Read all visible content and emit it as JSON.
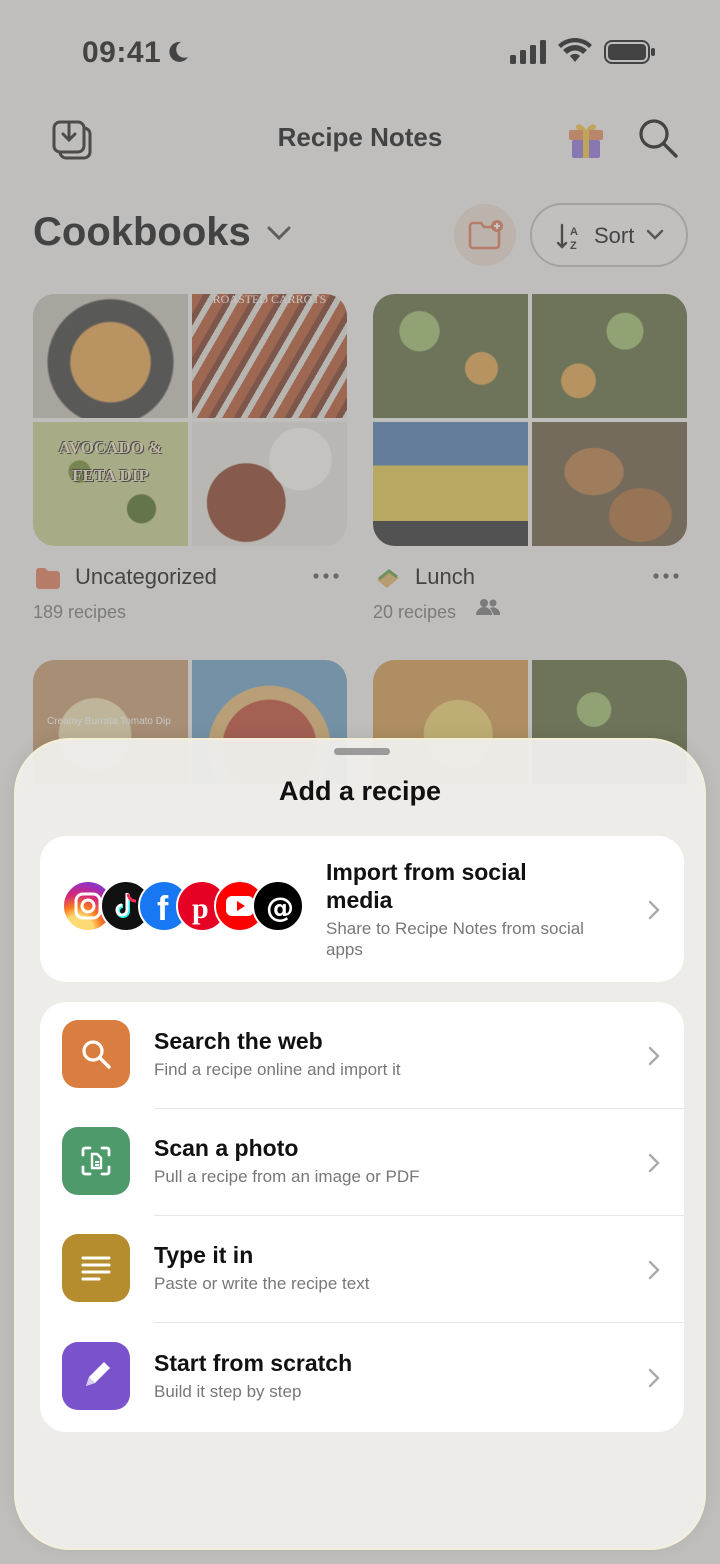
{
  "status_bar": {
    "time": "09:41"
  },
  "top_bar": {
    "title": "Recipe Notes"
  },
  "cookbooks": {
    "title": "Cookbooks",
    "sort_label": "Sort",
    "cards": [
      {
        "name": "Uncategorized",
        "count": "189 recipes",
        "tile_labels": [
          "ROASTED CARROTS",
          "AVOCADO & FETA DIP"
        ]
      },
      {
        "name": "Lunch",
        "count": "20 recipes",
        "shared": true
      }
    ],
    "partial_tile_label": "Creamy Burrata Tomato Dip"
  },
  "sheet": {
    "title": "Add a recipe",
    "social": {
      "title": "Import from social media",
      "subtitle": "Share to Recipe Notes from social apps",
      "icons": [
        "instagram-icon",
        "tiktok-icon",
        "facebook-icon",
        "pinterest-icon",
        "youtube-icon",
        "threads-icon"
      ]
    },
    "options": [
      {
        "title": "Search the web",
        "subtitle": "Find a recipe online and import it",
        "color": "#D97E40",
        "icon": "search-icon"
      },
      {
        "title": "Scan a photo",
        "subtitle": "Pull a recipe from an image or PDF",
        "color": "#4E9A6B",
        "icon": "scan-icon"
      },
      {
        "title": "Type it in",
        "subtitle": "Paste or write the recipe text",
        "color": "#B58D2E",
        "icon": "text-lines-icon"
      },
      {
        "title": "Start from scratch",
        "subtitle": "Build it step by step",
        "color": "#7A52CC",
        "icon": "pencil-icon"
      }
    ]
  },
  "colors": {
    "accent": "#E07B55",
    "background": "#F3F1EF"
  }
}
